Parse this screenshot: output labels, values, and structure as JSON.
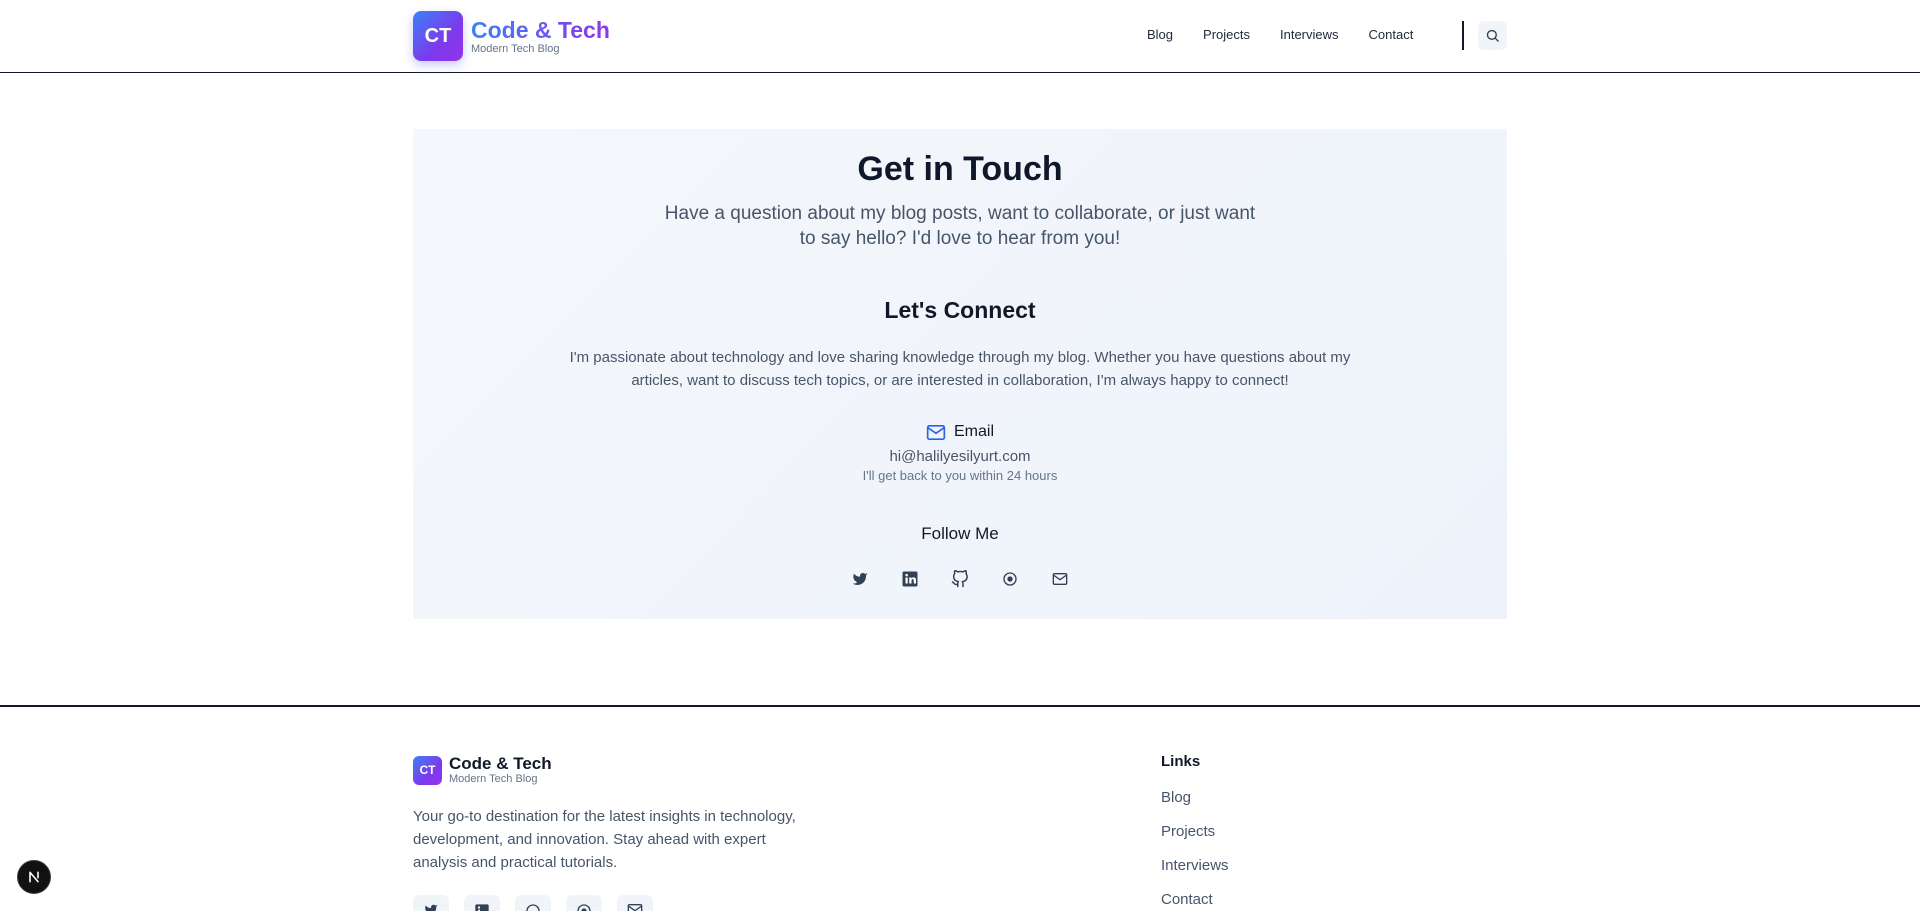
{
  "header": {
    "logo_initials": "CT",
    "brand_title": "Code & Tech",
    "brand_subtitle": "Modern Tech Blog",
    "nav": [
      {
        "label": "Blog"
      },
      {
        "label": "Projects"
      },
      {
        "label": "Interviews"
      },
      {
        "label": "Contact"
      }
    ],
    "search_icon": "search-icon"
  },
  "contact": {
    "title": "Get in Touch",
    "intro": "Have a question about my blog posts, want to collaborate, or just want to say hello? I'd love to hear from you!",
    "connect_title": "Let's Connect",
    "connect_text": "I'm passionate about technology and love sharing knowledge through my blog. Whether you have questions about my articles, want to discuss tech topics, or are interested in collaboration, I'm always happy to connect!",
    "email_label": "Email",
    "email_address": "hi@halilyesilyurt.com",
    "email_note": "I'll get back to you within 24 hours",
    "follow_title": "Follow Me",
    "socials": [
      "twitter-icon",
      "linkedin-icon",
      "github-icon",
      "medium-icon",
      "mail-icon"
    ]
  },
  "footer": {
    "logo_initials": "CT",
    "brand_title": "Code & Tech",
    "brand_subtitle": "Modern Tech Blog",
    "description": "Your go-to destination for the latest insights in technology, development, and innovation. Stay ahead with expert analysis and practical tutorials.",
    "links_title": "Links",
    "links": [
      {
        "label": "Blog"
      },
      {
        "label": "Projects"
      },
      {
        "label": "Interviews"
      },
      {
        "label": "Contact"
      }
    ]
  },
  "dev_badge": {
    "label": "N"
  },
  "colors": {
    "accent_blue": "#3b82f6",
    "accent_purple": "#9333ea",
    "text_dark": "#0f172a",
    "text_muted": "#475569",
    "card_bg": "#f4f7fb"
  }
}
